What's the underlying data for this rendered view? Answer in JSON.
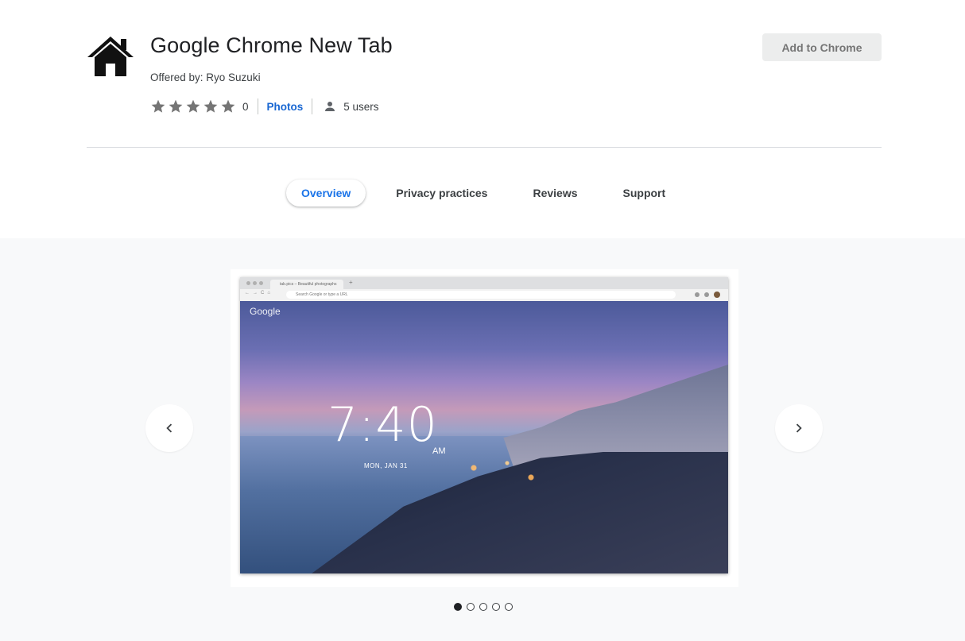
{
  "extension": {
    "title": "Google Chrome New Tab",
    "offered_by": "Offered by: Ryo Suzuki",
    "rating_count": "0",
    "photos_label": "Photos",
    "users_label": "5 users",
    "rating_stars": 0,
    "max_stars": 5,
    "icon": "house-icon"
  },
  "actions": {
    "add_label": "Add to Chrome"
  },
  "tabs": [
    {
      "label": "Overview",
      "active": true
    },
    {
      "label": "Privacy practices",
      "active": false
    },
    {
      "label": "Reviews",
      "active": false
    },
    {
      "label": "Support",
      "active": false
    }
  ],
  "screenshot": {
    "tab_title": "tab.pics – Beautiful photographs",
    "omnibox_text": "Search Google or type a URL",
    "brand": "Google",
    "time": "7:40",
    "ampm": "AM",
    "date": "MON, JAN 31"
  },
  "carousel": {
    "total": 5,
    "current": 1,
    "prev_icon": "chevron-left-icon",
    "next_icon": "chevron-right-icon"
  },
  "colors": {
    "link": "#1967d2",
    "active_tab": "#1a73e8",
    "star": "#757575",
    "button_bg": "#eceded"
  }
}
